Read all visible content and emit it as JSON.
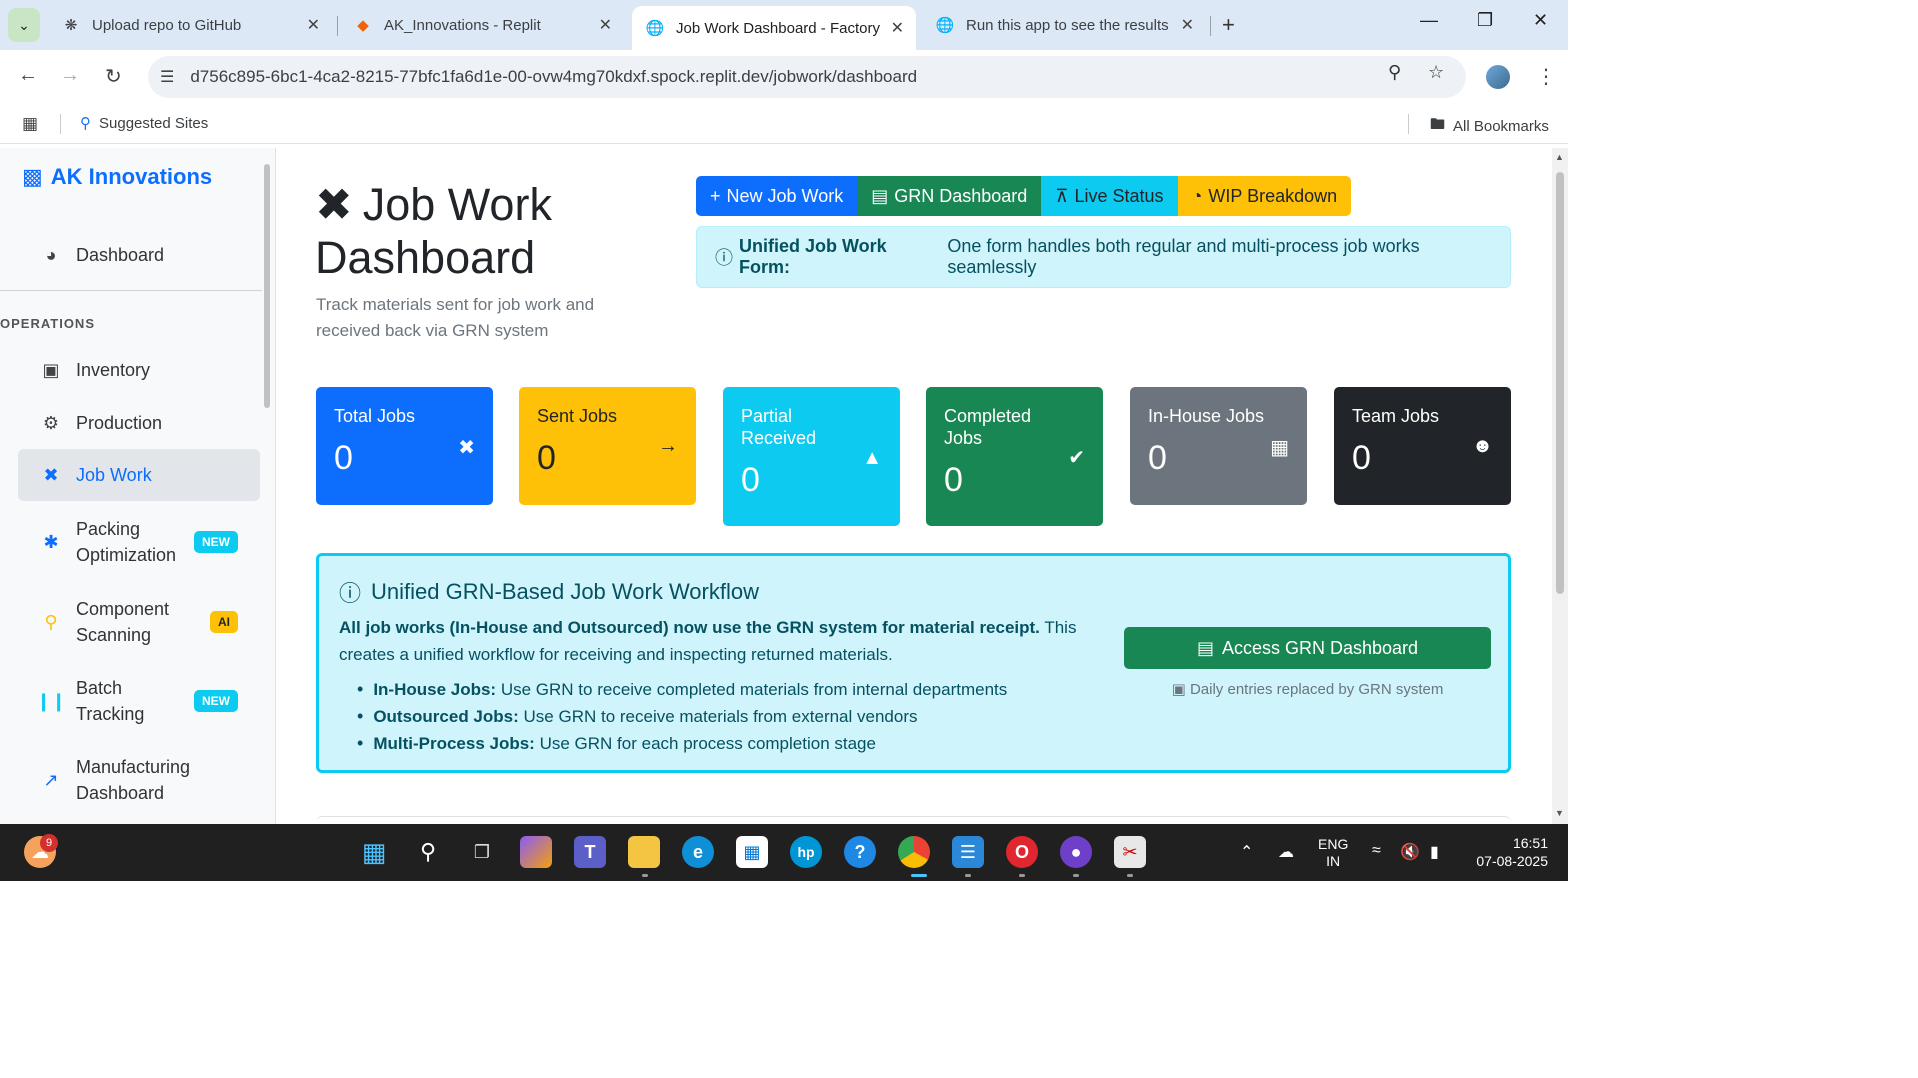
{
  "browser": {
    "tabs": [
      {
        "title": "Upload repo to GitHub",
        "icon": "openai-icon"
      },
      {
        "title": "AK_Innovations - Replit",
        "icon": "replit-icon"
      },
      {
        "title": "Job Work Dashboard - Factory M",
        "icon": "globe-icon"
      },
      {
        "title": "Run this app to see the results h",
        "icon": "globe-icon"
      }
    ],
    "url": "d756c895-6bc1-4ca2-8215-77bfc1fa6d1e-00-ovw4mg70kdxf.spock.replit.dev/jobwork/dashboard",
    "bookmarks": {
      "suggested": "Suggested Sites",
      "all": "All Bookmarks"
    }
  },
  "sidebar": {
    "brand": "AK Innovations",
    "dashboard": "Dashboard",
    "section_heading": "OPERATIONS",
    "items": [
      {
        "label": "Inventory",
        "icon": "boxes-icon"
      },
      {
        "label": "Production",
        "icon": "gears-icon"
      },
      {
        "label": "Job Work",
        "icon": "tools-icon"
      },
      {
        "label": "Packing Optimization",
        "icon": "puzzle-icon",
        "badge": "NEW"
      },
      {
        "label": "Component Scanning",
        "icon": "search-icon",
        "badge": "AI"
      },
      {
        "label": "Batch Tracking",
        "icon": "barcode-icon",
        "badge": "NEW"
      },
      {
        "label": "Manufacturing Dashboard",
        "icon": "chart-line-icon"
      }
    ]
  },
  "header": {
    "title": "Job Work Dashboard",
    "subtitle": "Track materials sent for job work and received back via GRN system",
    "buttons": {
      "new_job": "New Job Work",
      "grn": "GRN Dashboard",
      "live": "Live Status",
      "wip": "WIP Breakdown"
    },
    "alert_bold": "Unified Job Work Form:",
    "alert_text": "One form handles both regular and multi-process job works seamlessly"
  },
  "stats": [
    {
      "label": "Total Jobs",
      "value": "0",
      "color": "#0d6efd",
      "icon": "tools-icon"
    },
    {
      "label": "Sent Jobs",
      "value": "0",
      "color": "#ffc107",
      "icon": "arrow-right-icon"
    },
    {
      "label": "Partial Received",
      "value": "0",
      "color": "#0dcaf0",
      "icon": "warning-icon"
    },
    {
      "label": "Completed Jobs",
      "value": "0",
      "color": "#198754",
      "icon": "check-circle-icon"
    },
    {
      "label": "In-House Jobs",
      "value": "0",
      "color": "#6c757d",
      "icon": "building-icon"
    },
    {
      "label": "Team Jobs",
      "value": "0",
      "color": "#212529",
      "icon": "users-icon"
    }
  ],
  "workflow": {
    "title": "Unified GRN-Based Job Work Workflow",
    "desc_bold": "All job works (In-House and Outsourced) now use the GRN system for material receipt.",
    "desc_rest": "This creates a unified workflow for receiving and inspecting returned materials.",
    "items": [
      {
        "bold": "In-House Jobs:",
        "text": "Use GRN to receive completed materials from internal departments"
      },
      {
        "bold": "Outsourced Jobs:",
        "text": "Use GRN to receive materials from external vendors"
      },
      {
        "bold": "Multi-Process Jobs:",
        "text": "Use GRN for each process completion stage"
      }
    ],
    "button": "Access GRN Dashboard",
    "note": "Daily entries replaced by GRN system"
  },
  "taskbar": {
    "notification_count": "9",
    "lang_line1": "ENG",
    "lang_line2": "IN",
    "time": "16:51",
    "date": "07-08-2025"
  }
}
